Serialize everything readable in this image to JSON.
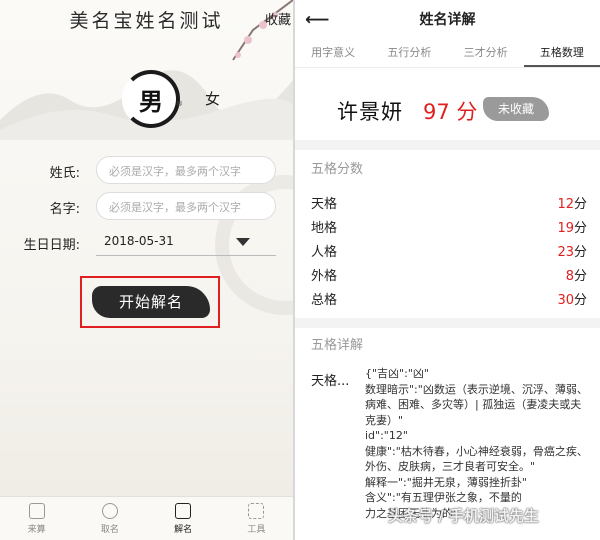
{
  "left": {
    "app_title": "美名宝姓名测试",
    "fav_label": "收藏",
    "gender": {
      "male": "男",
      "male_mark": "®",
      "female": "女"
    },
    "form": {
      "surname_label": "姓氏:",
      "surname_placeholder": "必须是汉字，最多两个汉字",
      "given_label": "名字:",
      "given_placeholder": "必须是汉字，最多两个汉字",
      "birth_label": "生日日期:",
      "birth_value": "2018-05-31"
    },
    "decode_button": "开始解名",
    "tabbar": [
      {
        "label": "来算",
        "icon": "calculate-icon"
      },
      {
        "label": "取名",
        "icon": "naming-icon"
      },
      {
        "label": "解名",
        "icon": "decode-icon"
      },
      {
        "label": "工具",
        "icon": "tools-icon"
      }
    ],
    "active_tab": 2
  },
  "right": {
    "title": "姓名详解",
    "tabs": [
      "用字意义",
      "五行分析",
      "三才分析",
      "五格数理"
    ],
    "active_tab": 3,
    "name": "许景妍",
    "score": "97 分",
    "fav_badge": "未收藏",
    "wuge_title": "五格分数",
    "wuge": [
      {
        "label": "天格",
        "value": "12",
        "unit": "分"
      },
      {
        "label": "地格",
        "value": "19",
        "unit": "分"
      },
      {
        "label": "人格",
        "value": "23",
        "unit": "分"
      },
      {
        "label": "外格",
        "value": "8",
        "unit": "分"
      },
      {
        "label": "总格",
        "value": "30",
        "unit": "分"
      }
    ],
    "detail_title": "五格详解",
    "detail_label": "天格...",
    "detail_text": "{\"吉凶\":\"凶\"\n数理暗示\":\"凶数运（表示逆境、沉浮、薄弱、病难、困难、多灾等）| 孤独运（妻凌夫或夫克妻）\"\nid\":\"12\"\n健康\":\"枯木待春，小心神经衰弱，骨癌之疾、外伤、皮肤病，三才良者可安全。\"\n解释一\":\"掘井无泉，薄弱挫折卦\"\n含义\":\"有五理伊张之象，不量的\n力之基困无能为的\"",
    "watermark": "头条号 / 手机测试先生"
  },
  "colors": {
    "accent_red": "#e02020",
    "ink": "#2a2a2a"
  }
}
